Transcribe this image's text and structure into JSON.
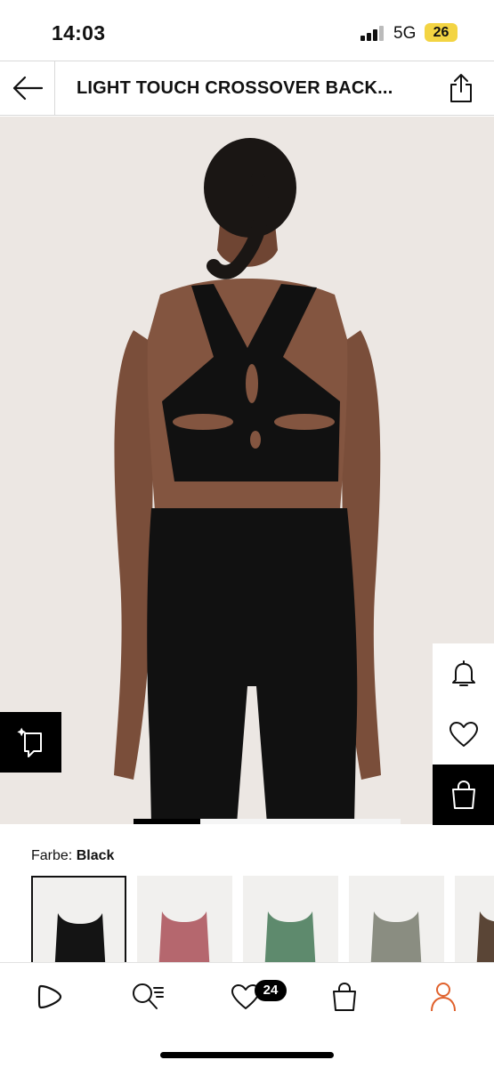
{
  "status_bar": {
    "time": "14:03",
    "network": "5G",
    "battery": "26"
  },
  "header": {
    "title": "LIGHT TOUCH CROSSOVER BACK...",
    "back_icon": "arrow-left-icon",
    "share_icon": "share-icon"
  },
  "product": {
    "image": "photo of model in black crossover-back sports bra and leggings",
    "gallery_progress": 0.25
  },
  "side_actions": [
    "bell-icon",
    "heart-icon",
    "shopping-bag-icon"
  ],
  "color": {
    "label": "Farbe:",
    "selected": "Black",
    "swatch_colors": [
      "#141414",
      "#b5676e",
      "#5e8a6d",
      "#8a8d81",
      "#5a4536"
    ]
  },
  "bottom_nav": {
    "items": [
      "home-icon",
      "search-icon",
      "wishlist-icon",
      "cart-icon",
      "profile-icon"
    ],
    "wishlist_count": "24",
    "accent": "#e0612c"
  }
}
